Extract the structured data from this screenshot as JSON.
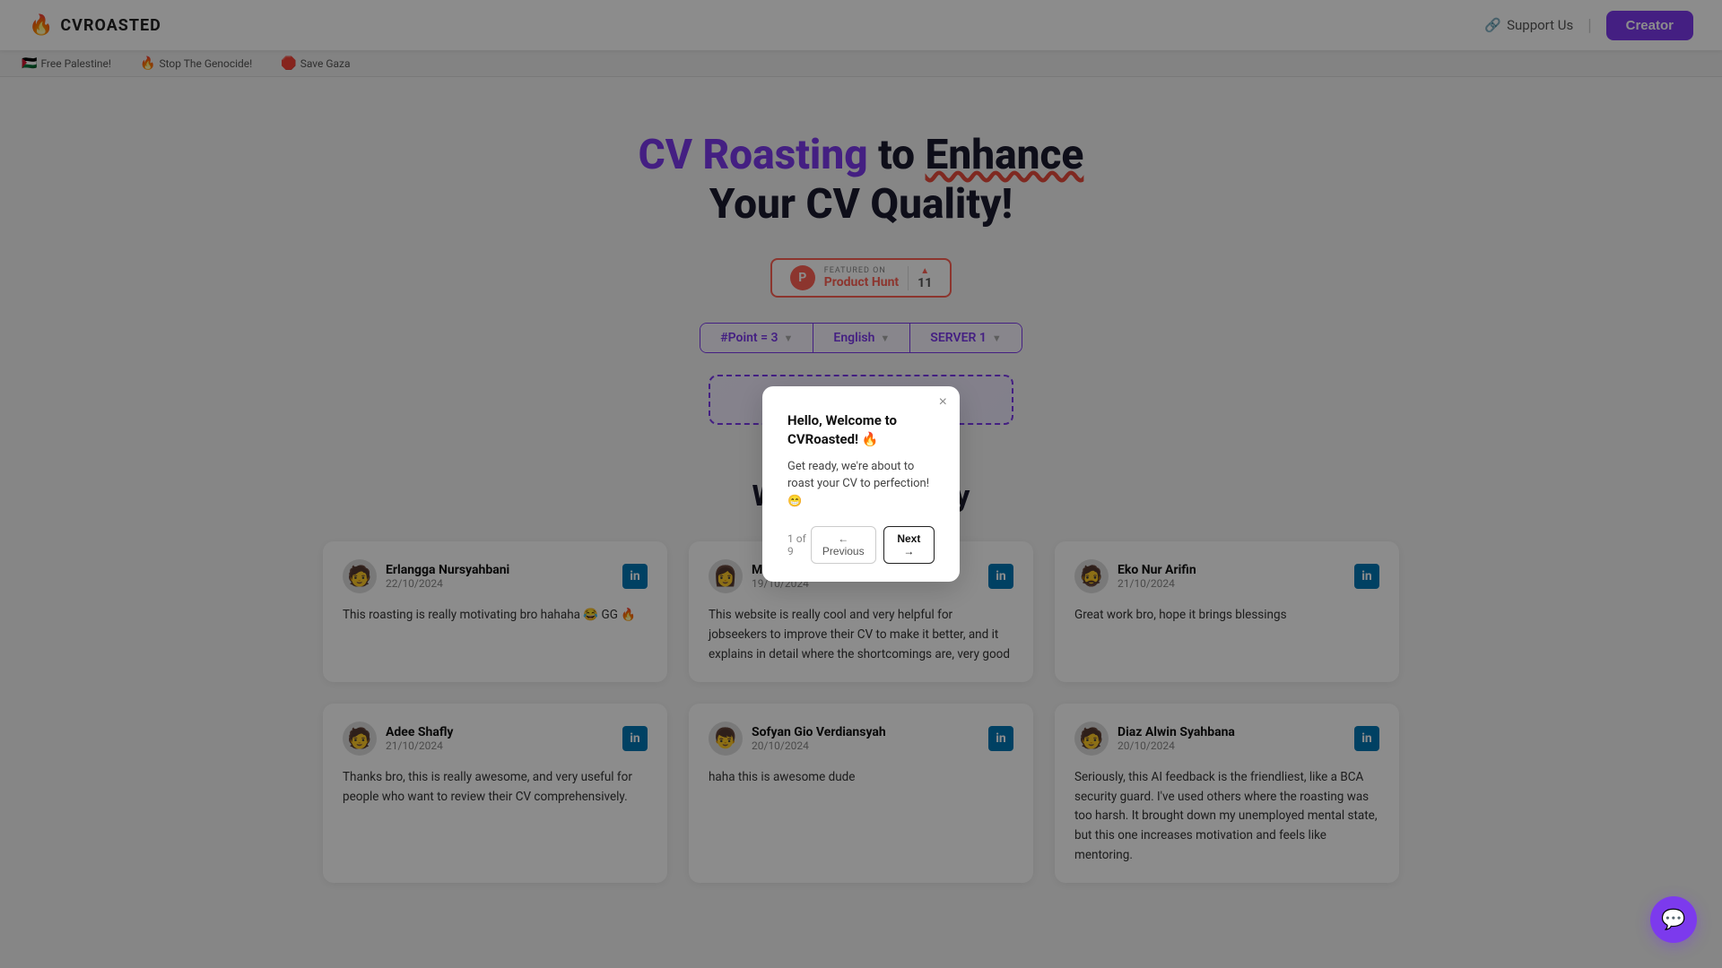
{
  "navbar": {
    "logo_icon": "🔥",
    "logo_text": "CVROASTED",
    "support_label": "Support Us",
    "divider": "|",
    "creator_label": "Creator"
  },
  "ticker": {
    "items": [
      {
        "flag": "🇵🇸",
        "text": "Free Palestine!"
      },
      {
        "flag": "🔥",
        "text": "Stop The Genocide!"
      },
      {
        "flag": "🛑",
        "text": "Save Gaza"
      }
    ]
  },
  "hero": {
    "title_part1": "CV Roasting",
    "title_part2": "to",
    "title_part3": "Enhance",
    "title_part4": "Your CV Quality!"
  },
  "product_hunt": {
    "featured_text": "FEATURED ON",
    "name": "Product Hunt",
    "count": "11"
  },
  "controls": {
    "point_label": "#Point = 3",
    "language_label": "English",
    "server_label": "SERVER 1"
  },
  "dialog": {
    "title": "Hello, Welcome to CVRoasted! 🔥",
    "body": "Get ready, we're about to roast your CV to perfection! 😁",
    "counter": "1 of 9",
    "prev_label": "← Previous",
    "next_label": "Next →",
    "close_label": "×"
  },
  "section": {
    "title": "What People Say"
  },
  "testimonials": [
    {
      "name": "Erlangga Nursyahbani",
      "date": "22/10/2024",
      "avatar_emoji": "🧑",
      "text": "This roasting is really motivating bro hahaha 😂 GG 🔥"
    },
    {
      "name": "Marchelia Putri Sannie",
      "date": "19/10/2024",
      "avatar_emoji": "👩",
      "text": "This website is really cool and very helpful for jobseekers to improve their CV to make it better, and it explains in detail where the shortcomings are, very good"
    },
    {
      "name": "Eko Nur Arifin",
      "date": "21/10/2024",
      "avatar_emoji": "🧔",
      "text": "Great work bro, hope it brings blessings"
    },
    {
      "name": "Adee Shafly",
      "date": "21/10/2024",
      "avatar_emoji": "🧑",
      "text": "Thanks bro, this is really awesome, and very useful for people who want to review their CV comprehensively."
    },
    {
      "name": "Sofyan Gio Verdiansyah",
      "date": "20/10/2024",
      "avatar_emoji": "👦",
      "text": "haha this is awesome dude"
    },
    {
      "name": "Diaz Alwin Syahbana",
      "date": "20/10/2024",
      "avatar_emoji": "🧑",
      "text": "Seriously, this AI feedback is the friendliest, like a BCA security guard. I've used others where the roasting was too harsh. It brought down my unemployed mental state, but this one increases motivation and feels like mentoring."
    }
  ],
  "chat_widget": {
    "icon": "💬"
  }
}
